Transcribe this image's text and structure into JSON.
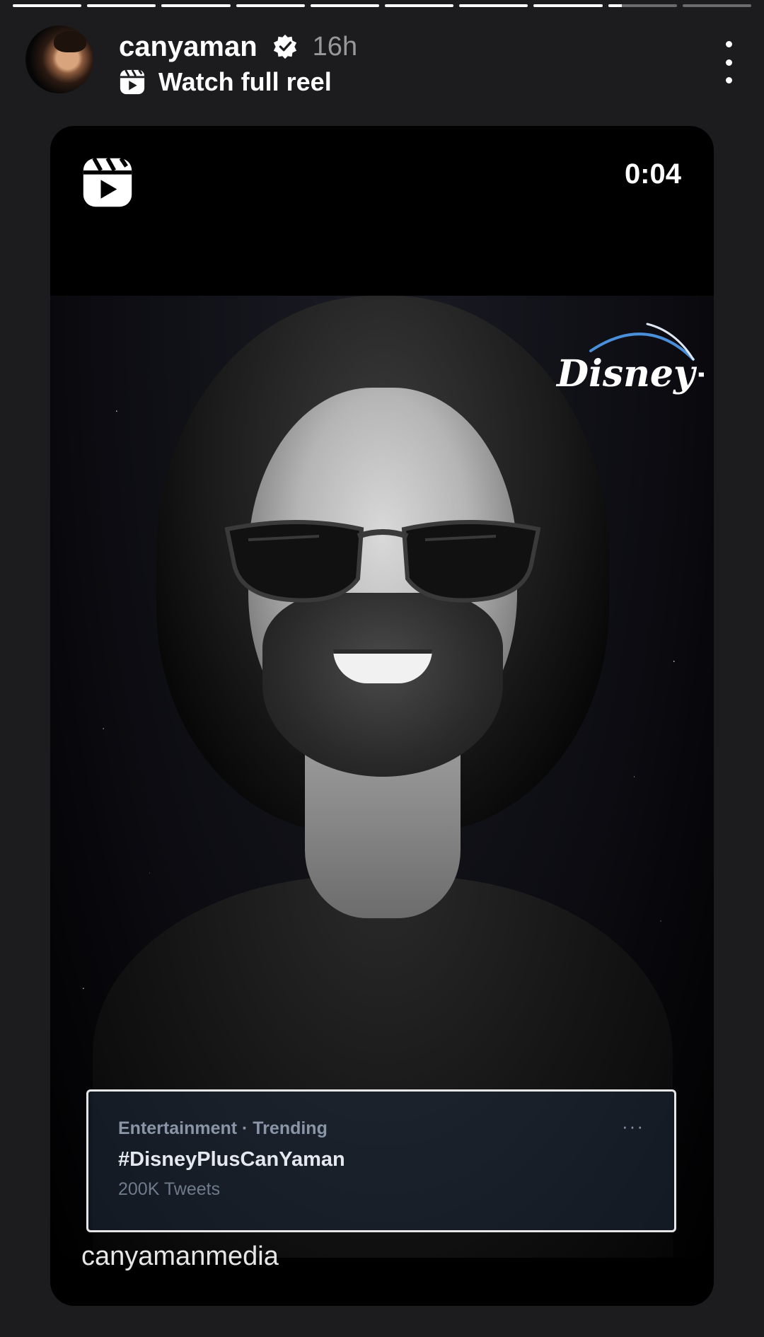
{
  "story_progress": [
    1,
    1,
    1,
    1,
    1,
    1,
    1,
    1,
    0.2,
    0
  ],
  "header": {
    "username": "canyaman",
    "verified": true,
    "time_ago": "16h",
    "reel_link_label": "Watch full reel",
    "avatar_icon": "profile-avatar",
    "more_icon": "more-vertical-icon"
  },
  "reel": {
    "duration": "0:04",
    "brand_logo_text": "Disney+",
    "trending_card": {
      "category": "Entertainment · Trending",
      "hashtag": "#DisneyPlusCanYaman",
      "tweet_count": "200K Tweets",
      "more": "···"
    },
    "watermark": "canyamanmedia"
  },
  "colors": {
    "background": "#1c1c1e",
    "card": "#000000",
    "text": "#ffffff",
    "muted": "#8e8e93"
  }
}
